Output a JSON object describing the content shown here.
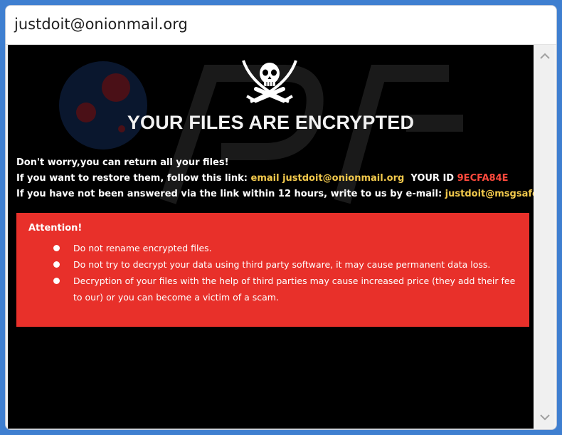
{
  "window": {
    "title": "justdoit@onionmail.org"
  },
  "icons": {
    "logo": "jolly-roger-skull-crossed-swords-icon",
    "scroll_up": "chevron-up-icon",
    "scroll_down": "chevron-down-icon",
    "bullet": "bullet-icon"
  },
  "colors": {
    "background": "#000000",
    "accent_yellow": "#f2c94c",
    "accent_red_text": "#ff4a3d",
    "attention_box": "#e8302a"
  },
  "message": {
    "headline": "YOUR FILES ARE ENCRYPTED",
    "line1": "Don't worry,you can return all your files!",
    "line2_prefix": "If you want to restore them, follow this link: ",
    "line2_link": "email justdoit@onionmail.org",
    "line2_id_label": "YOUR ID",
    "line2_id_value": "9ECFA84E",
    "line3_prefix": "If you have not been answered via the link within 12 hours, write to us by e-mail: ",
    "line3_email": "justdoit@msgsafe.io"
  },
  "attention": {
    "title": "Attention!",
    "items": [
      "Do not rename encrypted files.",
      "Do not try to decrypt your data using third party software, it may cause permanent data loss.",
      "Decryption of your files with the help of third parties may cause increased price (they add their fee to our) or you can become a victim of a scam."
    ]
  }
}
